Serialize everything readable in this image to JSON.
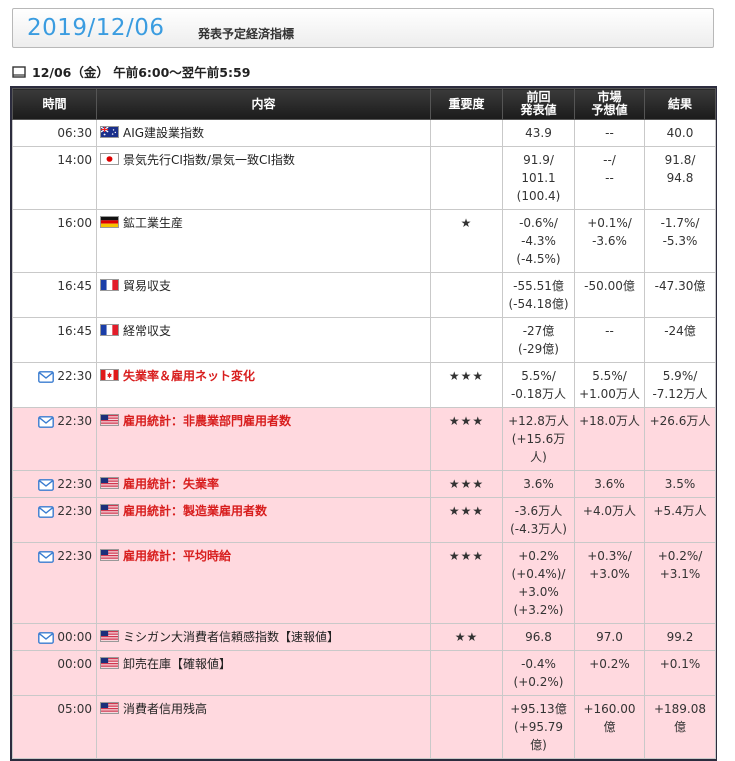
{
  "header": {
    "date": "2019/12/06",
    "subtitle": "発表予定経済指標"
  },
  "range": {
    "text": "12/06（金） 午前6:00～翌午前5:59"
  },
  "columns": {
    "time": "時間",
    "content": "内容",
    "importance": "重要度",
    "prev_line1": "前回",
    "prev_line2": "発表値",
    "fc_line1": "市場",
    "fc_line2": "予想値",
    "result": "結果"
  },
  "rows": [
    {
      "time": "06:30",
      "flag": "au",
      "mail": false,
      "bold": false,
      "title": "AIG建設業指数",
      "importance": "",
      "prev": [
        "43.9"
      ],
      "forecast": [
        "--"
      ],
      "result": [
        "40.0"
      ],
      "us": false
    },
    {
      "time": "14:00",
      "flag": "jp",
      "mail": false,
      "bold": false,
      "title": "景気先行CI指数/景気一致CI指数",
      "importance": "",
      "prev": [
        "91.9/",
        "101.1",
        "(100.4)"
      ],
      "forecast": [
        "--/",
        "--"
      ],
      "result": [
        "91.8/",
        "94.8"
      ],
      "us": false
    },
    {
      "time": "16:00",
      "flag": "de",
      "mail": false,
      "bold": false,
      "title": "鉱工業生産",
      "importance": "★",
      "prev": [
        "-0.6%/",
        "-4.3%",
        "(-4.5%)"
      ],
      "forecast": [
        "+0.1%/",
        "-3.6%"
      ],
      "result": [
        "-1.7%/",
        "-5.3%"
      ],
      "us": false
    },
    {
      "time": "16:45",
      "flag": "fr",
      "mail": false,
      "bold": false,
      "title": "貿易収支",
      "importance": "",
      "prev": [
        "-55.51億",
        "(-54.18億)"
      ],
      "forecast": [
        "-50.00億"
      ],
      "result": [
        "-47.30億"
      ],
      "us": false
    },
    {
      "time": "16:45",
      "flag": "fr",
      "mail": false,
      "bold": false,
      "title": "経常収支",
      "importance": "",
      "prev": [
        "-27億",
        "(-29億)"
      ],
      "forecast": [
        "--"
      ],
      "result": [
        "-24億"
      ],
      "us": false
    },
    {
      "time": "22:30",
      "flag": "ca",
      "mail": true,
      "bold": true,
      "title": "失業率＆雇用ネット変化",
      "importance": "★★★",
      "prev": [
        "5.5%/",
        "-0.18万人"
      ],
      "forecast": [
        "5.5%/",
        "+1.00万人"
      ],
      "result": [
        "5.9%/",
        "-7.12万人"
      ],
      "us": false
    },
    {
      "time": "22:30",
      "flag": "us",
      "mail": true,
      "bold": true,
      "title": "雇用統計：非農業部門雇用者数",
      "importance": "★★★",
      "prev": [
        "+12.8万人",
        "(+15.6万",
        "人)"
      ],
      "forecast": [
        "+18.0万人"
      ],
      "result": [
        "+26.6万人"
      ],
      "us": true
    },
    {
      "time": "22:30",
      "flag": "us",
      "mail": true,
      "bold": true,
      "title": "雇用統計：失業率",
      "importance": "★★★",
      "prev": [
        "3.6%"
      ],
      "forecast": [
        "3.6%"
      ],
      "result": [
        "3.5%"
      ],
      "us": true
    },
    {
      "time": "22:30",
      "flag": "us",
      "mail": true,
      "bold": true,
      "title": "雇用統計：製造業雇用者数",
      "importance": "★★★",
      "prev": [
        "-3.6万人",
        "(-4.3万人)"
      ],
      "forecast": [
        "+4.0万人"
      ],
      "result": [
        "+5.4万人"
      ],
      "us": true
    },
    {
      "time": "22:30",
      "flag": "us",
      "mail": true,
      "bold": true,
      "title": "雇用統計：平均時給",
      "importance": "★★★",
      "prev": [
        "+0.2%",
        "(+0.4%)/",
        "+3.0%",
        "(+3.2%)"
      ],
      "forecast": [
        "+0.3%/",
        "+3.0%"
      ],
      "result": [
        "+0.2%/",
        "+3.1%"
      ],
      "us": true
    },
    {
      "time": "00:00",
      "flag": "us",
      "mail": true,
      "bold": false,
      "title": "ミシガン大消費者信頼感指数【速報値】",
      "importance": "★★",
      "prev": [
        "96.8"
      ],
      "forecast": [
        "97.0"
      ],
      "result": [
        "99.2"
      ],
      "us": true
    },
    {
      "time": "00:00",
      "flag": "us",
      "mail": false,
      "bold": false,
      "title": "卸売在庫【確報値】",
      "importance": "",
      "prev": [
        "-0.4%",
        "(+0.2%)"
      ],
      "forecast": [
        "+0.2%"
      ],
      "result": [
        "+0.1%"
      ],
      "us": true
    },
    {
      "time": "05:00",
      "flag": "us",
      "mail": false,
      "bold": false,
      "title": "消費者信用残高",
      "importance": "",
      "prev": [
        "+95.13億",
        "(+95.79",
        "億)"
      ],
      "forecast": [
        "+160.00億"
      ],
      "result": [
        "+189.08億"
      ],
      "us": true
    }
  ]
}
